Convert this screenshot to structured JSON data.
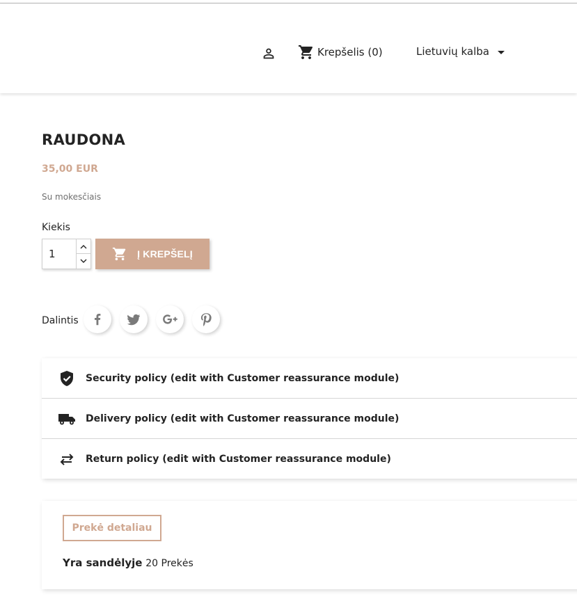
{
  "header": {
    "cart_label": "Krepšelis (0)",
    "language": "Lietuvių kalba"
  },
  "product": {
    "title": "RAUDONA",
    "price": "35,00 EUR",
    "tax_note": "Su mokesčiais",
    "quantity_label": "Kiekis",
    "quantity_value": "1",
    "add_to_cart_label": "Į KREPŠELĮ",
    "share_label": "Dalintis"
  },
  "share_icons": [
    "facebook-icon",
    "twitter-icon",
    "google-plus-icon",
    "pinterest-icon"
  ],
  "reassurance": [
    {
      "icon": "shield-icon",
      "text": "Security policy (edit with Customer reassurance module)"
    },
    {
      "icon": "truck-icon",
      "text": "Delivery policy (edit with Customer reassurance module)"
    },
    {
      "icon": "swap-arrows-icon",
      "text": "Return policy (edit with Customer reassurance module)"
    }
  ],
  "details": {
    "tab_label": "Prekė detaliau",
    "stock_label": "Yra sandėlyje",
    "stock_value": "20 Prekės"
  },
  "colors": {
    "accent": "#d0a891",
    "text": "#232323",
    "muted": "#6f6f6f"
  }
}
